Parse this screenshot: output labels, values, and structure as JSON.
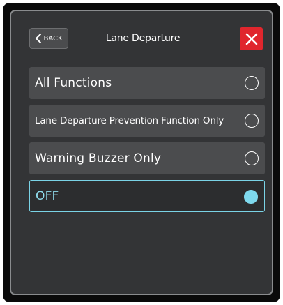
{
  "header": {
    "back_label": "BACK",
    "title": "Lane Departure"
  },
  "icons": {
    "back": "chevron-left-icon",
    "close": "close-icon"
  },
  "options": [
    {
      "label": "All Functions",
      "selected": false
    },
    {
      "label": "Lane Departure Prevention Function Only",
      "selected": false
    },
    {
      "label": "Warning Buzzer Only",
      "selected": false
    },
    {
      "label": "OFF",
      "selected": true
    }
  ],
  "colors": {
    "accent": "#7fd9ee",
    "close_button": "#e0262d",
    "panel": "#333436",
    "option": "#4b4c4e"
  }
}
